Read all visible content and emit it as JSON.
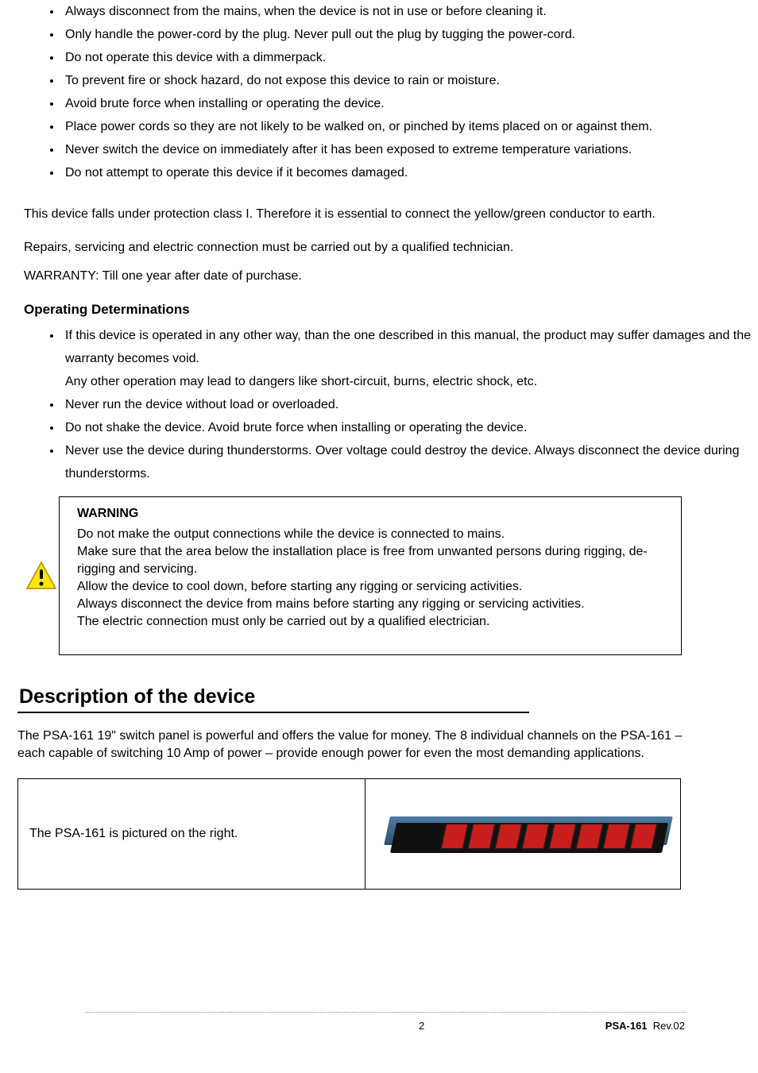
{
  "list1": [
    "Always disconnect from the mains, when the device is not in use or before cleaning it.",
    "Only handle the power-cord by the plug. Never pull out the plug by tugging the power-cord.",
    "Do not operate this device with a dimmerpack.",
    "To prevent fire or shock hazard, do not expose this device to rain or moisture.",
    "Avoid brute force when installing or operating the device.",
    "Place power cords so they are not likely to be walked on, or pinched by items placed on or against them.",
    "Never switch the device on immediately after it has been exposed to extreme temperature variations.",
    "Do not attempt to operate this device if it becomes damaged."
  ],
  "para1": "This device falls under protection class I. Therefore it is essential to connect the yellow/green conductor to earth.",
  "para2": "Repairs, servicing and electric connection must be carried out by a qualified technician.",
  "para3": "WARRANTY: Till one year after date of purchase.",
  "operating_heading": "Operating Determinations",
  "list2_intro": "If this device is operated in any other way, than the one described in this manual, the product may suffer damages and the warranty becomes void.",
  "list2_lead": "Any other operation may lead to dangers like short-circuit, burns, electric shock, etc.",
  "list2": [
    "Never run the device without load or overloaded.",
    "Do not shake the device. Avoid brute force when installing or operating the device.",
    "Never use the device during thunderstorms. Over voltage could destroy the device. Always disconnect the device during thunderstorms."
  ],
  "warning": {
    "title": "WARNING",
    "lines": [
      "Do not make the output connections while the device is connected to mains.",
      "Make sure that the area below the installation place is free from unwanted persons during rigging, de-rigging and servicing.",
      "Allow the device to cool down, before starting any rigging or servicing activities.",
      "Always disconnect the device from mains before starting any rigging or servicing activities.",
      "The electric connection must only be carried out by a qualified electrician."
    ]
  },
  "section_title": "Description of the device",
  "section_para": "The PSA-161 19\" switch panel is powerful and offers the value for money. The 8 individual channels on the PSA-161 – each capable of switching 10 Amp of power – provide enough power for even the most demanding applications.",
  "table": {
    "left": "The PSA-161 is pictured on the right.",
    "image_alt": "PSA-161 rack switch panel"
  },
  "footer": {
    "page": "2",
    "product": "PSA-161",
    "rev": "Rev.02"
  }
}
